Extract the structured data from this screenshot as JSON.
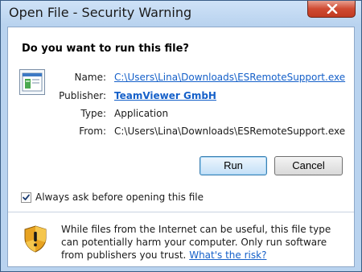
{
  "window": {
    "title": "Open File - Security Warning"
  },
  "dialog": {
    "question": "Do you want to run this file?",
    "file_icon": "executable-file-icon",
    "fields": {
      "name_label": "Name:",
      "name_value": "C:\\Users\\Lina\\Downloads\\ESRemoteSupport.exe",
      "publisher_label": "Publisher:",
      "publisher_value": "TeamViewer GmbH",
      "type_label": "Type:",
      "type_value": "Application",
      "from_label": "From:",
      "from_value": "C:\\Users\\Lina\\Downloads\\ESRemoteSupport.exe"
    },
    "buttons": {
      "run": "Run",
      "cancel": "Cancel"
    },
    "checkbox": {
      "label": "Always ask before opening this file",
      "checked": true
    },
    "warning": {
      "icon": "security-shield-icon",
      "text": "While files from the Internet can be useful, this file type can potentially harm your computer. Only run software from publishers you trust.",
      "link": "What's the risk?"
    }
  },
  "colors": {
    "link": "#1560c9",
    "close_button": "#c13b22",
    "titlebar": "#b9d3ef"
  }
}
